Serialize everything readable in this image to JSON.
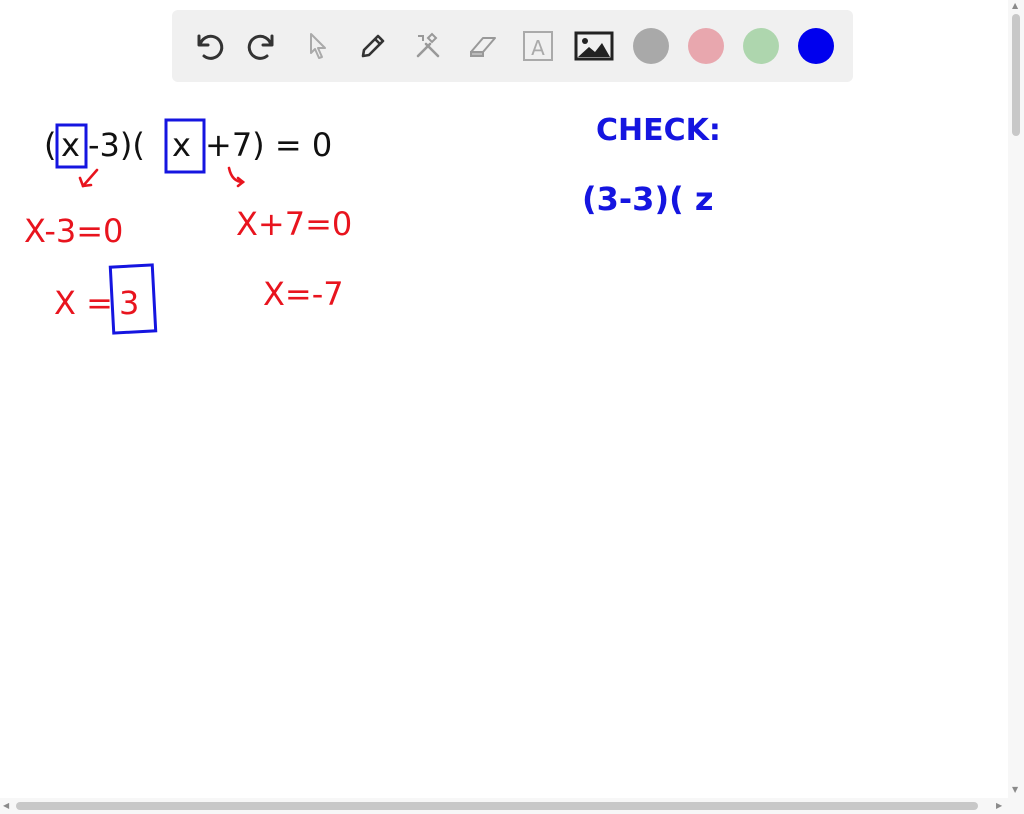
{
  "toolbar": {
    "tools": [
      {
        "name": "undo-icon"
      },
      {
        "name": "redo-icon"
      },
      {
        "name": "select-pointer-icon"
      },
      {
        "name": "pen-icon"
      },
      {
        "name": "tools-icon"
      },
      {
        "name": "eraser-icon"
      },
      {
        "name": "text-icon",
        "glyph": "A"
      },
      {
        "name": "image-icon"
      }
    ],
    "colors": [
      "#a9a9a9",
      "#e8a7ae",
      "#aed6ae",
      "#0000ee"
    ],
    "selected_color": "#0000ee"
  },
  "board": {
    "ink_black": "#111111",
    "ink_red": "#e8141e",
    "ink_blue": "#1515e0",
    "equation_left": "(",
    "equation_x1": "x",
    "equation_mid": "-3)(",
    "equation_x2": "x",
    "equation_right": "+7) = 0",
    "case1_eq": "X-3=0",
    "case1_lhs": "X =",
    "case1_sol": "3",
    "case2_eq": "X+7=0",
    "case2_sol": "X=-7",
    "check_label": "CHECK:",
    "check_work": "(3-3)( z"
  }
}
